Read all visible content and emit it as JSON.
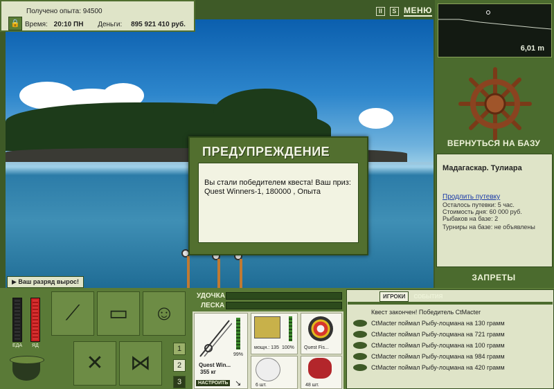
{
  "hud": {
    "exp_label": "Получено опыта:",
    "exp_value": "94500",
    "time_label": "Время:",
    "time_value": "20:10 ПН",
    "money_label": "Деньги:",
    "money_value": "895 921 410 руб."
  },
  "top_buttons": {
    "pause": "II",
    "sound": "S",
    "menu": "МЕНЮ"
  },
  "depth": {
    "value": "6,01 m"
  },
  "base": {
    "return_button": "ВЕРНУТЬСЯ НА БАЗУ",
    "location": "Мадагаскар. Тулиара",
    "extend_link": "Продлить путевку",
    "remaining": "Осталось путевки: 5 час.",
    "day_cost": "Стоимость дня: 60 000 руб.",
    "anglers": "Рыбаков на базе: 2",
    "tournaments": "Турниры на базе: не объявлены",
    "bans_button": "ЗАПРЕТЫ"
  },
  "dialog": {
    "title": "ПРЕДУПРЕЖДЕНИЕ",
    "message": "Вы стали победителем квеста! Ваш приз: Quest Winners-1, 180000 , Опыта"
  },
  "toast": {
    "text": "Ваш разряд вырос!"
  },
  "status_bars": {
    "food_label": "ЕДА",
    "poison_label": "ЯД"
  },
  "pages": [
    "1",
    "2",
    "3"
  ],
  "tackle": {
    "rod_label": "УДОЧКА",
    "line_label": "ЛЕСКА",
    "rod_name": "Quest Win...",
    "rod_weight": "355 кг",
    "rod_percent": "99%",
    "reel_power": "мощн.: 135",
    "reel_percent": "100%",
    "line_name": "Quest Fis...",
    "hook_count": "6 шт.",
    "bait_count": "48 шт.",
    "setup_button": "НАСТРОИТЬ"
  },
  "log": {
    "tabs": [
      "ИГРОКИ",
      "СОБЫТИЯ"
    ],
    "lines": [
      "Квест закончен! Победитель CtMacter",
      "CtMacter поймал Рыбу-лоцмана на 130 грамм",
      "CtMacter поймал Рыбу-лоцмана на 721 грамм",
      "CtMacter поймал Рыбу-лоцмана на 100 грамм",
      "CtMacter поймал Рыбу-лоцмана на 984 грамм",
      "CtMacter поймал Рыбу-лоцмана на 420 грамм"
    ]
  },
  "colors": {
    "panel_green": "#4b6b2e",
    "light_panel": "#dfe4c8",
    "bar_red": "#c72020",
    "bar_green": "#3d8a2c"
  }
}
